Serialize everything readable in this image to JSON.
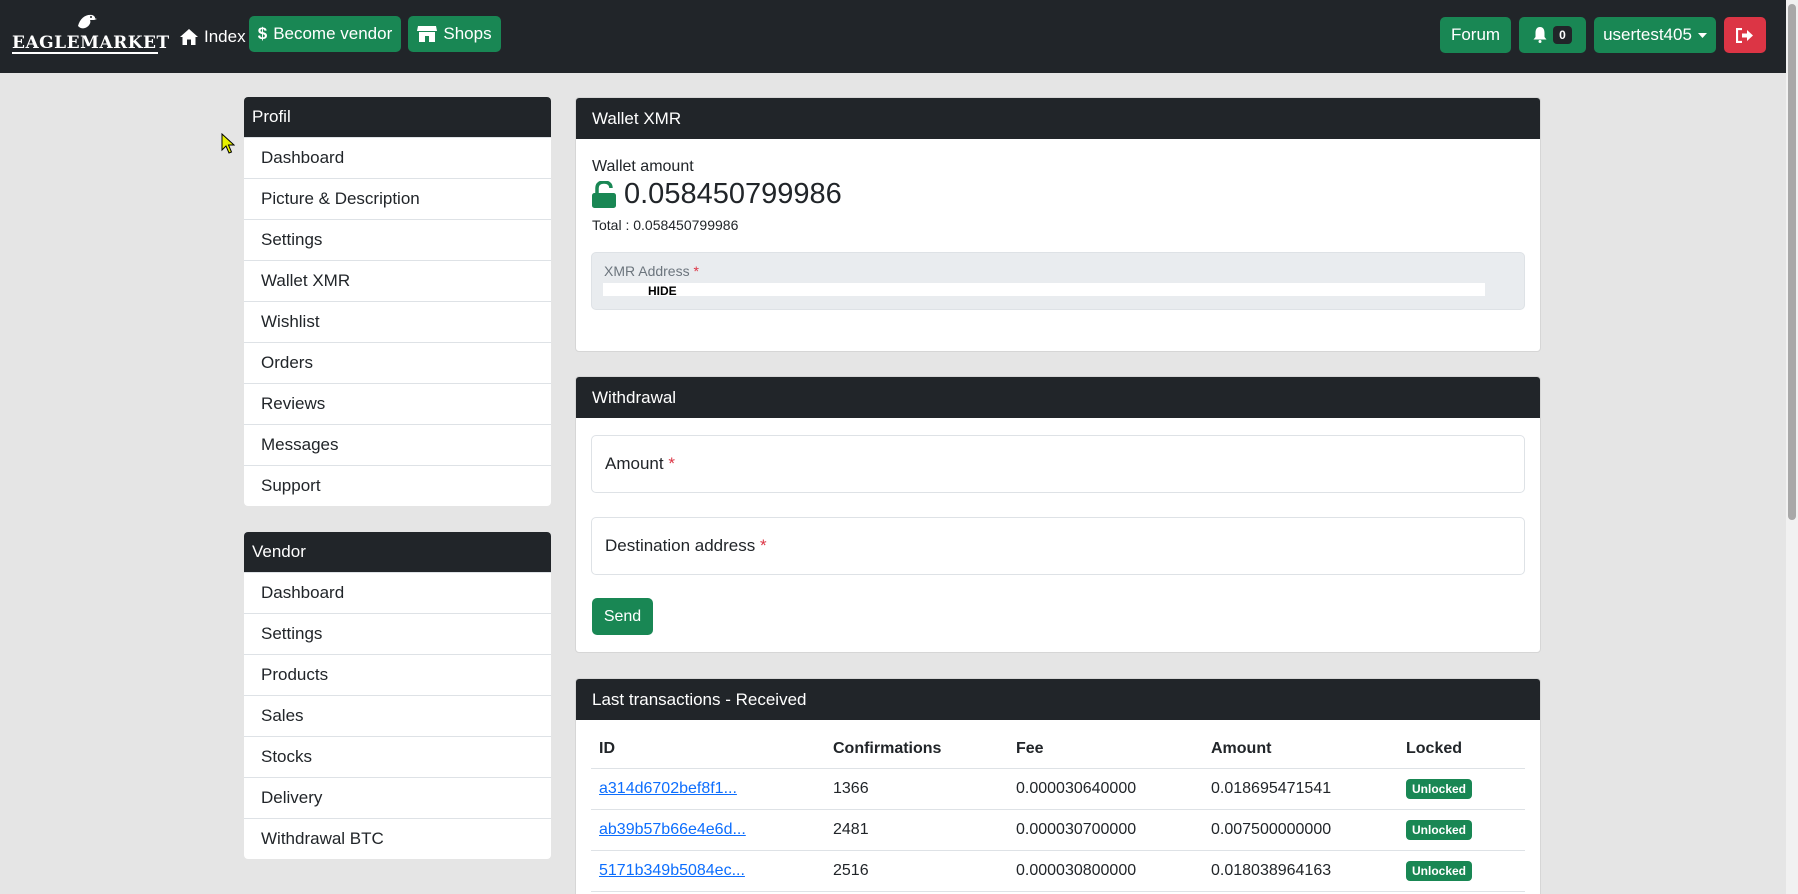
{
  "nav": {
    "logo_text": "EAGLEMARKET",
    "index_label": "Index",
    "become_vendor_label": "Become vendor",
    "shops_label": "Shops",
    "forum_label": "Forum",
    "notifications_count": "0",
    "username": "usertest405",
    "icons": [
      "home-icon",
      "dollar-icon",
      "shop-icon",
      "bell-icon",
      "caret-down-icon",
      "logout-icon"
    ],
    "colors": {
      "accent_green": "#198754",
      "danger_red": "#dc3545",
      "dark": "#212529"
    }
  },
  "sidebar": {
    "profil": {
      "title": "Profil",
      "items": [
        "Dashboard",
        "Picture & Description",
        "Settings",
        "Wallet XMR",
        "Wishlist",
        "Orders",
        "Reviews",
        "Messages",
        "Support"
      ]
    },
    "vendor": {
      "title": "Vendor",
      "items": [
        "Dashboard",
        "Settings",
        "Products",
        "Sales",
        "Stocks",
        "Delivery",
        "Withdrawal BTC"
      ]
    }
  },
  "wallet": {
    "title": "Wallet XMR",
    "amount_label": "Wallet amount",
    "amount": "0.058450799986",
    "total": "Total : 0.058450799986",
    "address_label": "XMR Address",
    "required_mark": "*",
    "hide_label": "HIDE"
  },
  "withdrawal": {
    "title": "Withdrawal",
    "amount_placeholder": "Amount",
    "destination_placeholder": "Destination address",
    "required_mark": "*",
    "send_label": "Send"
  },
  "transactions": {
    "title": "Last transactions - Received",
    "columns": [
      "ID",
      "Confirmations",
      "Fee",
      "Amount",
      "Locked"
    ],
    "rows": [
      {
        "id": "a314d6702bef8f1...",
        "confirmations": "1366",
        "fee": "0.000030640000",
        "amount": "0.018695471541",
        "locked": "Unlocked"
      },
      {
        "id": "ab39b57b66e4e6d...",
        "confirmations": "2481",
        "fee": "0.000030700000",
        "amount": "0.007500000000",
        "locked": "Unlocked"
      },
      {
        "id": "5171b349b5084ec...",
        "confirmations": "2516",
        "fee": "0.000030800000",
        "amount": "0.018038964163",
        "locked": "Unlocked"
      }
    ]
  }
}
